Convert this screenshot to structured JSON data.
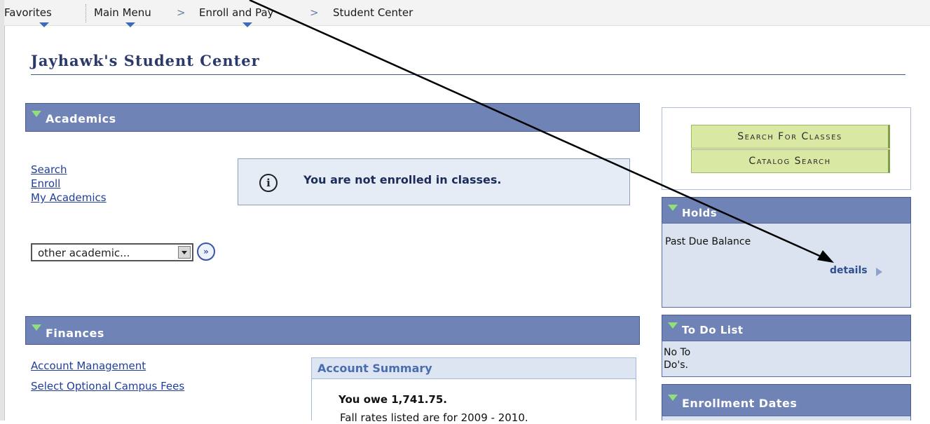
{
  "breadcrumb": {
    "favorites": "Favorites",
    "main_menu": "Main Menu",
    "enroll_and_pay": "Enroll and Pay",
    "student_center": "Student Center",
    "separator": ">"
  },
  "page": {
    "title": "Jayhawk's Student Center"
  },
  "academics": {
    "header": "Academics",
    "links": [
      "Search",
      "Enroll",
      "My Academics"
    ],
    "notice": "You are not enrolled in classes.",
    "dropdown_value": "other academic...",
    "go_symbol": "»"
  },
  "finances": {
    "header": "Finances",
    "links": [
      "Account Management",
      "Select Optional Campus Fees"
    ],
    "account_summary": {
      "title": "Account Summary",
      "owe_text": "You owe 1,741.75.",
      "note": "Fall rates listed are for 2009 - 2010."
    }
  },
  "sidebar": {
    "search_for_classes": "Search For Classes",
    "catalog_search": "Catalog Search",
    "holds": {
      "header": "Holds",
      "item": "Past Due Balance",
      "details": "details"
    },
    "todo": {
      "header": "To Do List",
      "line1": "No To",
      "line2": "Do's."
    },
    "enrollment_dates": {
      "header": "Enrollment Dates"
    }
  },
  "colors": {
    "section_header": "#7083b6",
    "triangle": "#8fe07a",
    "green_button": "#d9e9a4",
    "link": "#1f3f9a"
  }
}
